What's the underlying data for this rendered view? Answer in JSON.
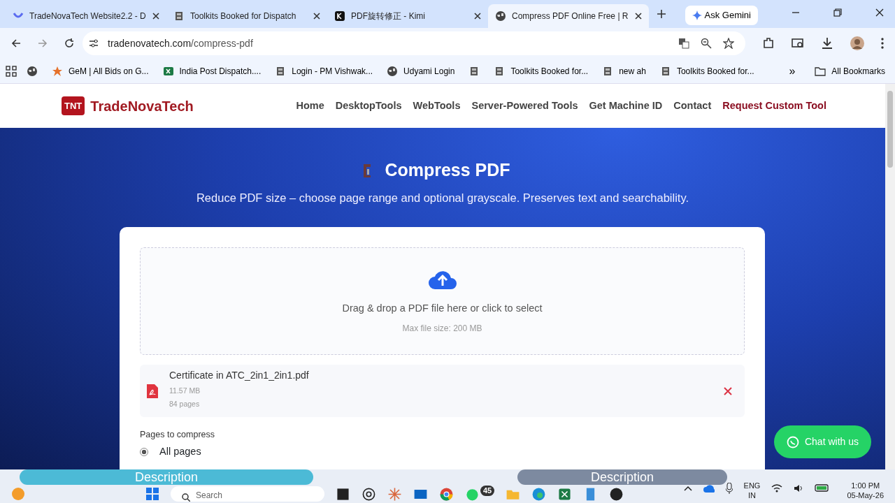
{
  "browser": {
    "tabs": [
      {
        "title": "TradeNovaTech Website2.2 - D",
        "selected": false
      },
      {
        "title": "Toolkits Booked for Dispatch",
        "selected": false
      },
      {
        "title": "PDF旋转修正 - Kimi",
        "selected": false
      },
      {
        "title": "Compress PDF Online Free | R",
        "selected": true
      }
    ],
    "gemini": "Ask Gemini",
    "address": {
      "host": "tradenovatech.com",
      "path": "/compress-pdf"
    },
    "bookmarks": [
      {
        "kind": "icon"
      },
      {
        "kind": "link",
        "label": "GeM | All Bids on G..."
      },
      {
        "kind": "link",
        "label": "India Post Dispatch...."
      },
      {
        "kind": "link",
        "label": "Login - PM Vishwak..."
      },
      {
        "kind": "link",
        "label": "Udyami Login"
      },
      {
        "kind": "icon"
      },
      {
        "kind": "link",
        "label": "Toolkits Booked for..."
      },
      {
        "kind": "link",
        "label": "new ah"
      },
      {
        "kind": "link",
        "label": "Toolkits Booked for..."
      }
    ],
    "more": "»",
    "all_bookmarks": "All Bookmarks"
  },
  "site": {
    "logo_mark": "TNT",
    "logo_name": "TradeNovaTech",
    "nav": [
      {
        "label": "Home",
        "highlight": false
      },
      {
        "label": "DesktopTools",
        "highlight": false
      },
      {
        "label": "WebTools",
        "highlight": false
      },
      {
        "label": "Server-Powered Tools",
        "highlight": false
      },
      {
        "label": "Get Machine ID",
        "highlight": false
      },
      {
        "label": "Contact",
        "highlight": false
      },
      {
        "label": "Request Custom Tool",
        "highlight": true
      }
    ],
    "hero": {
      "title": "Compress PDF",
      "subtitle": "Reduce PDF size – choose page range and optional grayscale. Preserves text and searchability."
    },
    "upload": {
      "prompt": "Drag & drop a PDF file here or click to select",
      "note": "Max file size: 200 MB"
    },
    "file": {
      "name": "Certificate in ATC_2in1_2in1.pdf",
      "size": "11.57 MB",
      "pages": "84 pages"
    },
    "pages_label": "Pages to compress",
    "options": [
      {
        "label": "All pages",
        "selected": true
      }
    ],
    "chat": "Chat with us"
  },
  "overlays": [
    "Description",
    "Description"
  ],
  "taskbar": {
    "search": "Search",
    "badge": "45",
    "lang": [
      "ENG",
      "IN"
    ],
    "time": "1:00 PM",
    "date": "05-May-26"
  }
}
